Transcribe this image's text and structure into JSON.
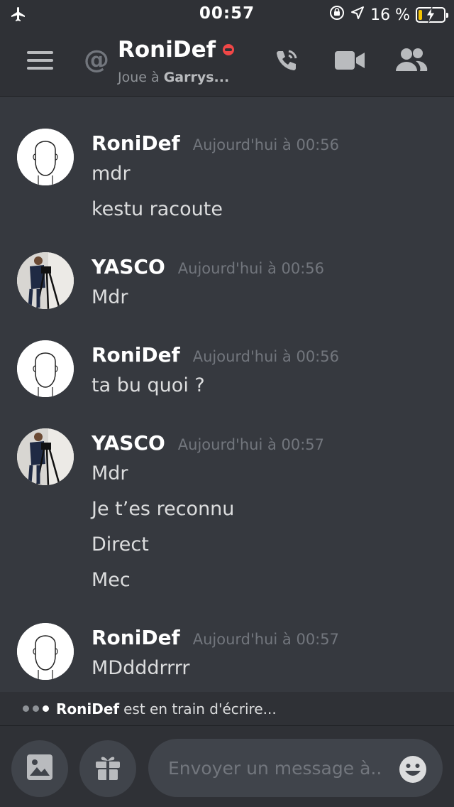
{
  "status_bar": {
    "time": "00:57",
    "battery_text": "16 %",
    "battery_level": 0.16,
    "icons": [
      "airplane-icon",
      "rotation-lock-icon",
      "location-arrow-icon",
      "battery-charging-icon"
    ]
  },
  "header": {
    "title": "RoniDef",
    "status_color": "#f04747",
    "subtitle_prefix": "Joue à ",
    "subtitle_game": "Garrys...",
    "icons": [
      "menu-icon",
      "at-icon",
      "phone-call-icon",
      "video-camera-icon",
      "members-icon"
    ]
  },
  "messages": [
    {
      "author": "RoniDef",
      "timestamp": "Aujourd'hui à 00:56",
      "lines": [
        "mdr",
        "kestu racoute"
      ]
    },
    {
      "author": "YASCO",
      "timestamp": "Aujourd'hui à 00:56",
      "lines": [
        "Mdr"
      ]
    },
    {
      "author": "RoniDef",
      "timestamp": "Aujourd'hui à 00:56",
      "lines": [
        "ta bu quoi ?"
      ]
    },
    {
      "author": "YASCO",
      "timestamp": "Aujourd'hui à 00:57",
      "lines": [
        "Mdr",
        "Je t’es reconnu",
        "Direct",
        "Mec"
      ]
    },
    {
      "author": "RoniDef",
      "timestamp": "Aujourd'hui à 00:57",
      "lines": [
        "MDdddrrrr"
      ]
    }
  ],
  "typing": {
    "user": "RoniDef",
    "text": "est en train d'écrire..."
  },
  "composer": {
    "placeholder": "Envoyer un message à..",
    "value": "",
    "icons": [
      "image-icon",
      "gift-icon",
      "emoji-icon"
    ]
  },
  "colors": {
    "background": "#36393f",
    "header": "#2f3136",
    "input": "#40444b",
    "dnd": "#f04747",
    "battery": "#f5c400"
  }
}
